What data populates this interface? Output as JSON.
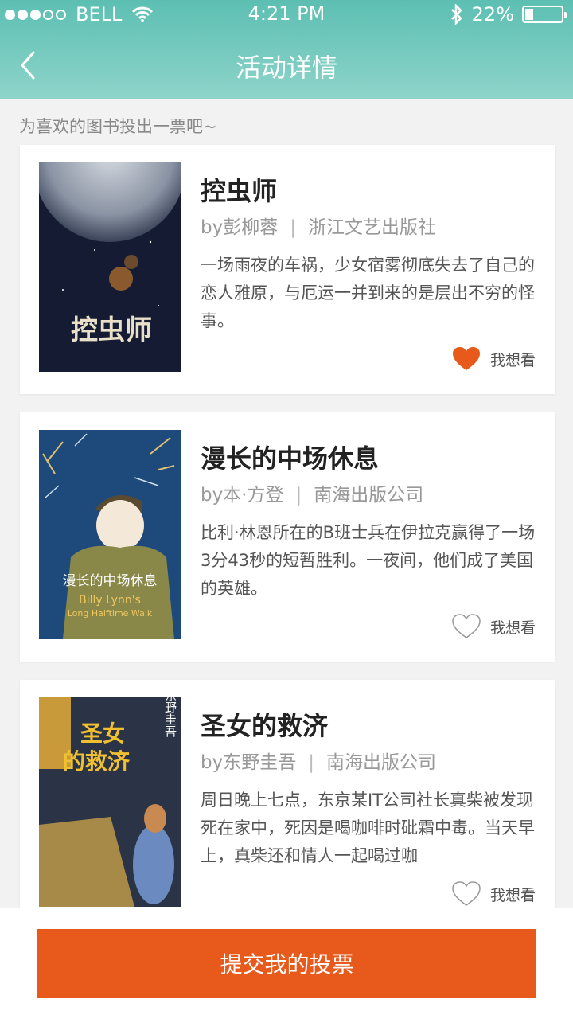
{
  "status_bar": {
    "carrier": "BELL",
    "time": "4:21 PM",
    "battery": "22%",
    "battery_level": 0.22,
    "signal_strength": 3,
    "icons": [
      "wifi-icon",
      "bluetooth-icon",
      "battery-icon"
    ]
  },
  "nav": {
    "title": "活动详情",
    "back_icon": "chevron-left-icon"
  },
  "intro": "为喜欢的图书投出一票吧~",
  "books": [
    {
      "title": "控虫师",
      "author": "by彭柳蓉",
      "publisher": "浙江文艺出版社",
      "description": "一场雨夜的车祸，少女宿雾彻底失去了自己的恋人雅原，与厄运一并到来的是层出不穷的怪事。",
      "want_label": "我想看",
      "liked": true,
      "cover_text": "控虫师"
    },
    {
      "title": "漫长的中场休息",
      "author": "by本·方登",
      "publisher": "南海出版公司",
      "description": "比利·林恩所在的B班士兵在伊拉克赢得了一场3分43秒的短暂胜利。一夜间，他们成了美国的英雄。",
      "want_label": "我想看",
      "liked": false,
      "cover_text": "漫长的中场休息",
      "cover_subtext": "Billy Lynn's Long Halftime Walk"
    },
    {
      "title": "圣女的救济",
      "author": "by东野圭吾",
      "publisher": "南海出版公司",
      "description": "周日晚上七点，东京某IT公司社长真柴被发现死在家中，死因是喝咖啡时砒霜中毒。当天早上，真柴还和情人一起喝过咖",
      "want_label": "我想看",
      "liked": false,
      "cover_text": "圣女的救济",
      "cover_author": "东野圭吾"
    }
  ],
  "submit_label": "提交我的投票",
  "colors": {
    "header_top": "#5cbfb2",
    "header_bottom": "#8ed4ca",
    "accent": "#e8591c",
    "heart_liked": "#e8591c",
    "heart_empty": "#999999"
  }
}
